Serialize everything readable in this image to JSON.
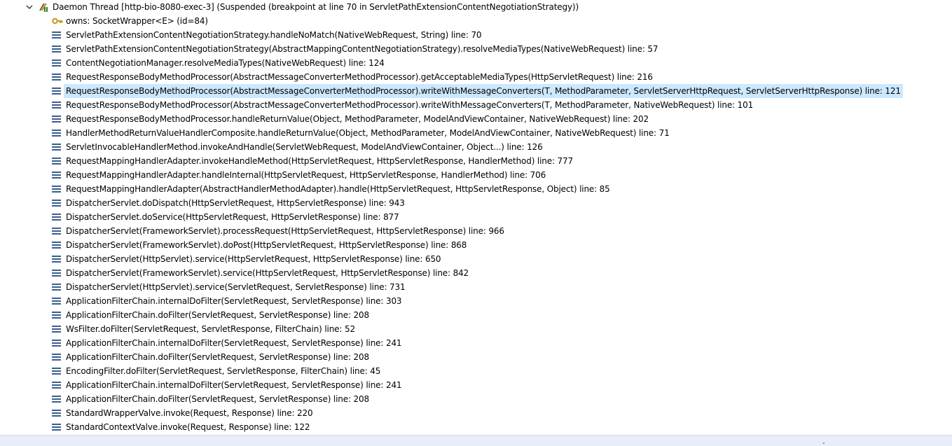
{
  "thread": {
    "label": "Daemon Thread [http-bio-8080-exec-3] (Suspended (breakpoint at line 70 in ServletPathExtensionContentNegotiationStrategy))",
    "icon": "thread-suspended-icon",
    "expanded": true
  },
  "owns": {
    "label": "owns: SocketWrapper<E>  (id=84)",
    "icon": "monitor-key-icon"
  },
  "colors": {
    "selection": "#cce8ff",
    "frame_icon": "#3b5e8c",
    "statusbar": "#e8eef7"
  },
  "frames": [
    {
      "label": "ServletPathExtensionContentNegotiationStrategy.handleNoMatch(NativeWebRequest, String) line: 70",
      "selected": false
    },
    {
      "label": "ServletPathExtensionContentNegotiationStrategy(AbstractMappingContentNegotiationStrategy).resolveMediaTypes(NativeWebRequest) line: 57",
      "selected": false
    },
    {
      "label": "ContentNegotiationManager.resolveMediaTypes(NativeWebRequest) line: 124",
      "selected": false
    },
    {
      "label": "RequestResponseBodyMethodProcessor(AbstractMessageConverterMethodProcessor).getAcceptableMediaTypes(HttpServletRequest) line: 216",
      "selected": false
    },
    {
      "label": "RequestResponseBodyMethodProcessor(AbstractMessageConverterMethodProcessor).writeWithMessageConverters(T, MethodParameter, ServletServerHttpRequest, ServletServerHttpResponse) line: 121",
      "selected": true
    },
    {
      "label": "RequestResponseBodyMethodProcessor(AbstractMessageConverterMethodProcessor).writeWithMessageConverters(T, MethodParameter, NativeWebRequest) line: 101",
      "selected": false
    },
    {
      "label": "RequestResponseBodyMethodProcessor.handleReturnValue(Object, MethodParameter, ModelAndViewContainer, NativeWebRequest) line: 202",
      "selected": false
    },
    {
      "label": "HandlerMethodReturnValueHandlerComposite.handleReturnValue(Object, MethodParameter, ModelAndViewContainer, NativeWebRequest) line: 71",
      "selected": false
    },
    {
      "label": "ServletInvocableHandlerMethod.invokeAndHandle(ServletWebRequest, ModelAndViewContainer, Object...) line: 126",
      "selected": false
    },
    {
      "label": "RequestMappingHandlerAdapter.invokeHandleMethod(HttpServletRequest, HttpServletResponse, HandlerMethod) line: 777",
      "selected": false
    },
    {
      "label": "RequestMappingHandlerAdapter.handleInternal(HttpServletRequest, HttpServletResponse, HandlerMethod) line: 706",
      "selected": false
    },
    {
      "label": "RequestMappingHandlerAdapter(AbstractHandlerMethodAdapter).handle(HttpServletRequest, HttpServletResponse, Object) line: 85",
      "selected": false
    },
    {
      "label": "DispatcherServlet.doDispatch(HttpServletRequest, HttpServletResponse) line: 943",
      "selected": false
    },
    {
      "label": "DispatcherServlet.doService(HttpServletRequest, HttpServletResponse) line: 877",
      "selected": false
    },
    {
      "label": "DispatcherServlet(FrameworkServlet).processRequest(HttpServletRequest, HttpServletResponse) line: 966",
      "selected": false
    },
    {
      "label": "DispatcherServlet(FrameworkServlet).doPost(HttpServletRequest, HttpServletResponse) line: 868",
      "selected": false
    },
    {
      "label": "DispatcherServlet(HttpServlet).service(HttpServletRequest, HttpServletResponse) line: 650",
      "selected": false
    },
    {
      "label": "DispatcherServlet(FrameworkServlet).service(HttpServletRequest, HttpServletResponse) line: 842",
      "selected": false
    },
    {
      "label": "DispatcherServlet(HttpServlet).service(ServletRequest, ServletResponse) line: 731",
      "selected": false
    },
    {
      "label": "ApplicationFilterChain.internalDoFilter(ServletRequest, ServletResponse) line: 303",
      "selected": false
    },
    {
      "label": "ApplicationFilterChain.doFilter(ServletRequest, ServletResponse) line: 208",
      "selected": false
    },
    {
      "label": "WsFilter.doFilter(ServletRequest, ServletResponse, FilterChain) line: 52",
      "selected": false
    },
    {
      "label": "ApplicationFilterChain.internalDoFilter(ServletRequest, ServletResponse) line: 241",
      "selected": false
    },
    {
      "label": "ApplicationFilterChain.doFilter(ServletRequest, ServletResponse) line: 208",
      "selected": false
    },
    {
      "label": "EncodingFilter.doFilter(ServletRequest, ServletResponse, FilterChain) line: 45",
      "selected": false
    },
    {
      "label": "ApplicationFilterChain.internalDoFilter(ServletRequest, ServletResponse) line: 241",
      "selected": false
    },
    {
      "label": "ApplicationFilterChain.doFilter(ServletRequest, ServletResponse) line: 208",
      "selected": false
    },
    {
      "label": "StandardWrapperValve.invoke(Request, Response) line: 220",
      "selected": false
    },
    {
      "label": "StandardContextValve.invoke(Request, Response) line: 122",
      "selected": false
    }
  ]
}
